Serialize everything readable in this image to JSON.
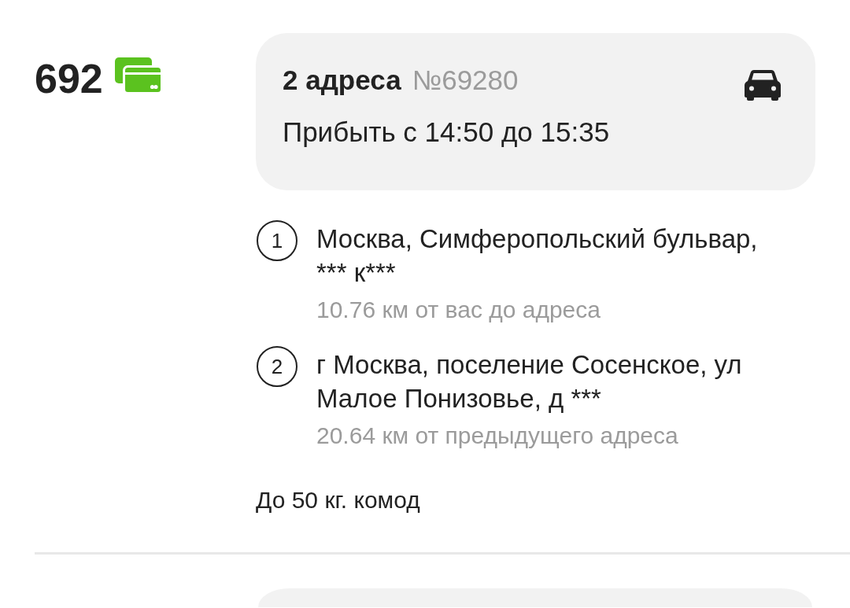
{
  "order": {
    "price": "692",
    "header": {
      "title": "2 адреса",
      "number": "№69280",
      "arrival": "Прибыть с 14:50 до 15:35"
    },
    "addresses": [
      {
        "index": "1",
        "address": "Москва, Симферопольский бульвар, *** к***",
        "distance": "10.76 км от вас до адреса"
      },
      {
        "index": "2",
        "address": "г Москва, поселение Сосенское, ул Малое Понизовье, д ***",
        "distance": "20.64 км от предыдущего адреса"
      }
    ],
    "note": "До 50 кг. комод"
  }
}
